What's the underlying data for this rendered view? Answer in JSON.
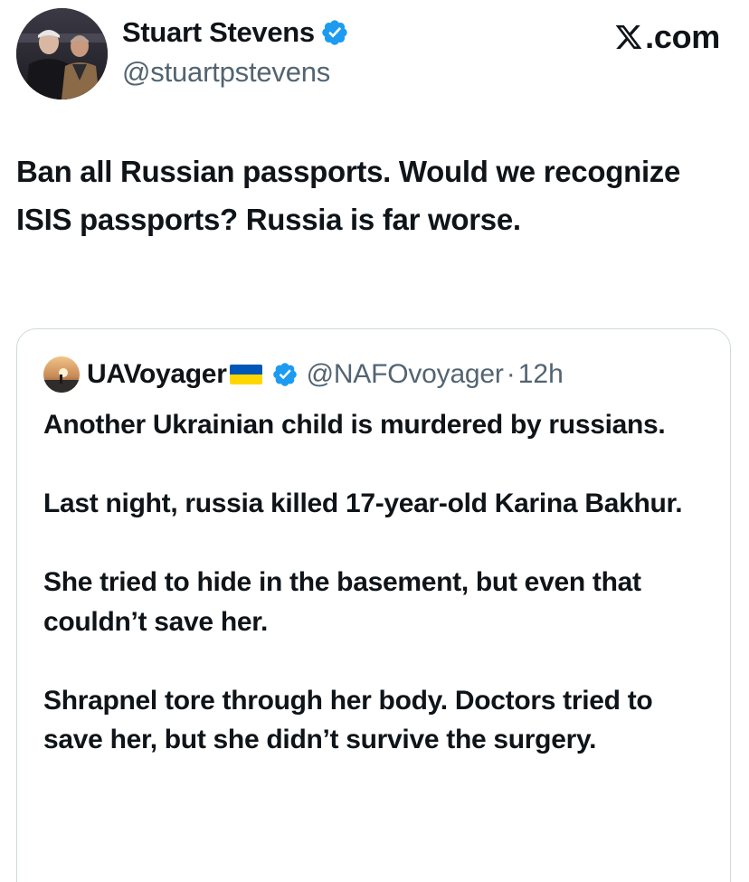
{
  "header": {
    "author_name": "Stuart Stevens",
    "author_handle": "@stuartpstevens",
    "brand": "X.com",
    "brand_suffix": ".com",
    "verified_color": "#1d9bf0"
  },
  "tweet": {
    "text": "Ban all Russian passports. Would we recognize ISIS passports? Russia is far worse."
  },
  "quote": {
    "author_name": "UAVoyager",
    "author_handle": "@NAFOvoyager",
    "separator": "·",
    "time": "12h",
    "paragraphs": [
      "Another Ukrainian child is murdered by russians.",
      "Last night, russia killed 17-year-old Karina Bakhur.",
      "She tried to hide in the basement, but even that couldn’t save her.",
      "Shrapnel tore through her body. Doctors tried to save her, but she didn’t survive the surgery."
    ]
  },
  "icons": {
    "verified": "verified-badge-icon",
    "flag": "ukraine-flag-icon",
    "brand": "x-logo-icon"
  }
}
